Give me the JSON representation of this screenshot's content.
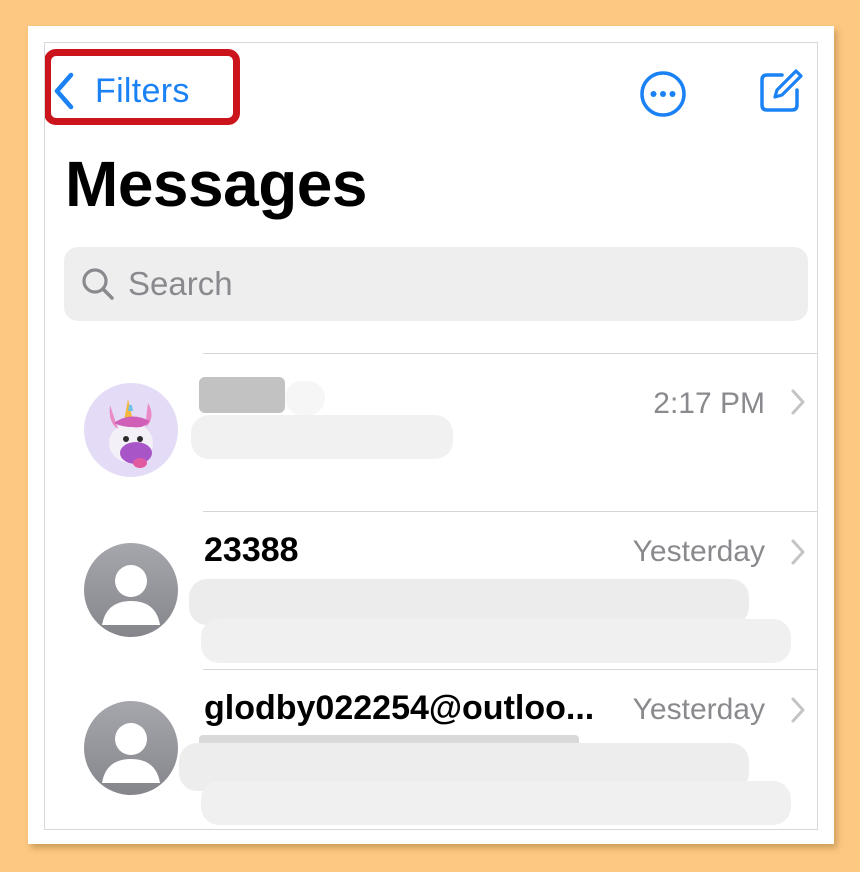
{
  "nav": {
    "back_label": "Filters",
    "back_icon": "chevron-left-icon",
    "more_icon": "ellipsis-circle-icon",
    "compose_icon": "compose-icon",
    "accent_color": "#1a82f5",
    "highlight_color": "#cc141c"
  },
  "page": {
    "title": "Messages"
  },
  "search": {
    "placeholder": "Search",
    "icon": "search-icon"
  },
  "conversations": [
    {
      "sender": "",
      "time": "2:17 PM",
      "avatar": "unicorn-memoji-avatar"
    },
    {
      "sender": "23388",
      "time": "Yesterday",
      "avatar": "default-person-avatar"
    },
    {
      "sender": "glodby022254@outloo...",
      "time": "Yesterday",
      "avatar": "default-person-avatar"
    }
  ]
}
